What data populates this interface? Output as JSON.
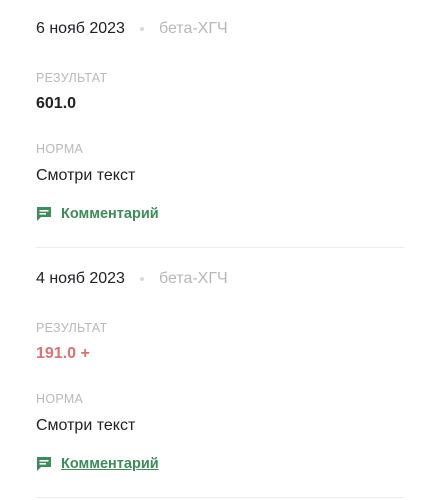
{
  "entries": [
    {
      "date": "6 нояб 2023",
      "test": "бета-ХГЧ",
      "result_label": "РЕЗУЛЬТАТ",
      "result": "601.0",
      "result_color": "#222222",
      "norm_label": "НОРМА",
      "norm": "Смотри текст",
      "comment_label": "Комментарий",
      "comment_icon": "comment-icon"
    },
    {
      "date": "4 нояб 2023",
      "test": "бета-ХГЧ",
      "result_label": "РЕЗУЛЬТАТ",
      "result": "191.0 +",
      "result_color": "#d9736f",
      "norm_label": "НОРМА",
      "norm": "Смотри текст",
      "comment_label": "Комментарий",
      "comment_icon": "comment-icon"
    }
  ],
  "colors": {
    "accent": "#3e8b5b",
    "abnormal": "#d9736f",
    "muted": "#b9b9b9"
  }
}
